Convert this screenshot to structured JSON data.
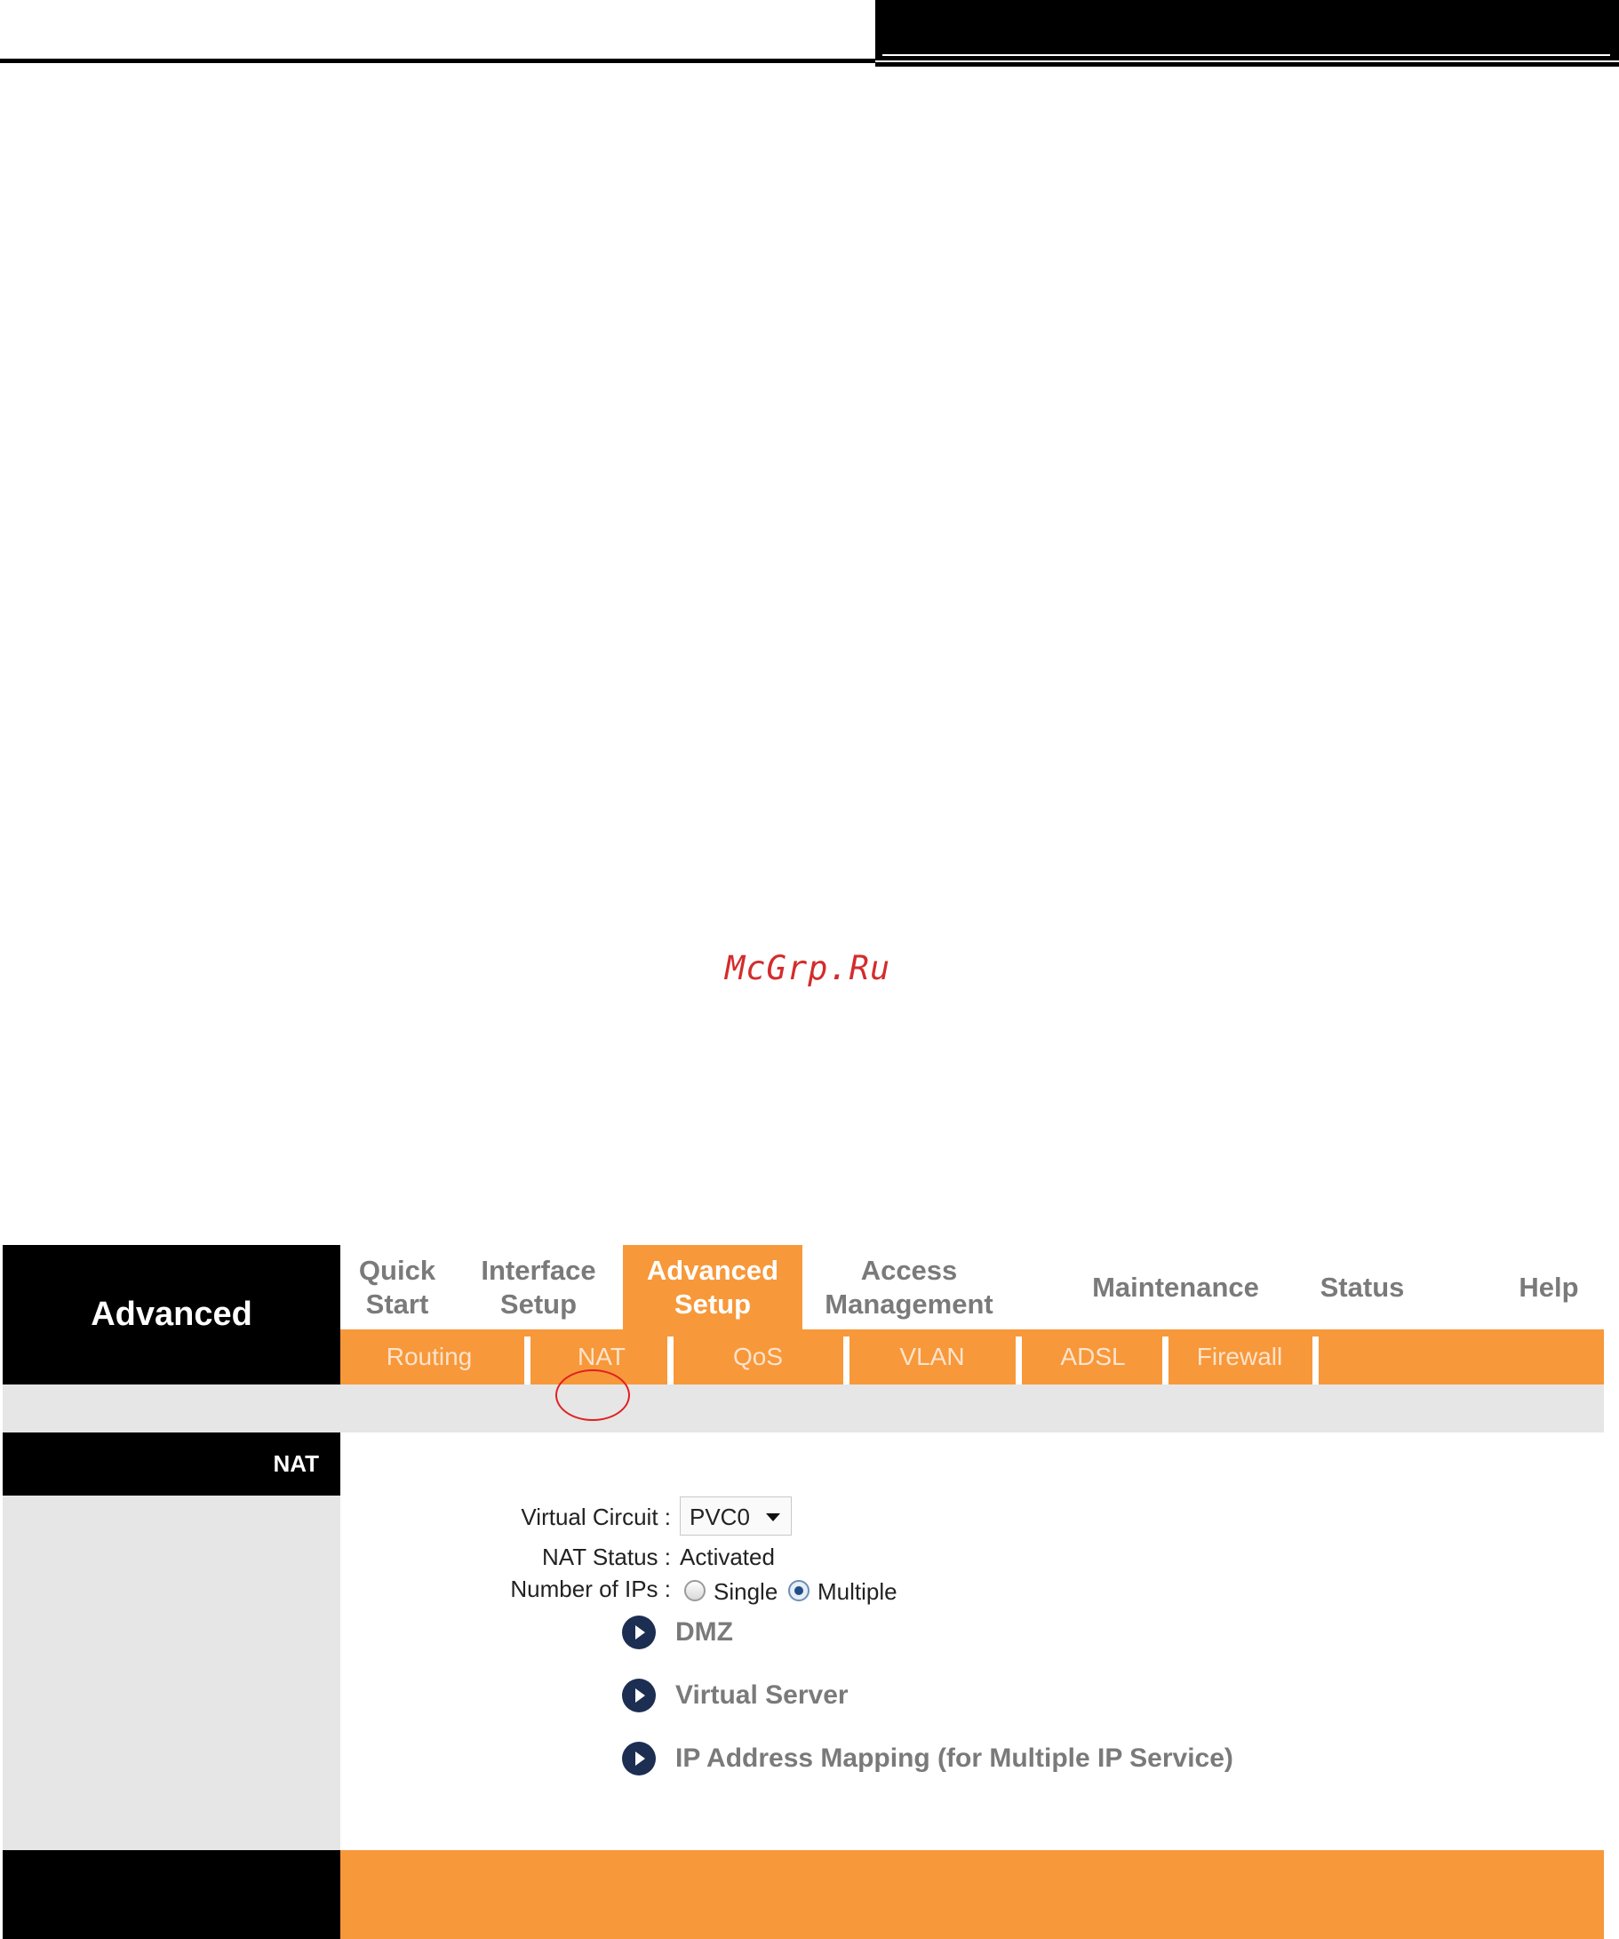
{
  "watermark": "McGrp.Ru",
  "app": {
    "section_title": "Advanced"
  },
  "nav": {
    "tabs": [
      {
        "label_line1": "Quick",
        "label_line2": "Start"
      },
      {
        "label_line1": "Interface",
        "label_line2": "Setup"
      },
      {
        "label_line1": "Advanced",
        "label_line2": "Setup"
      },
      {
        "label_line1": "Access",
        "label_line2": "Management"
      },
      {
        "label_line1": "Maintenance"
      },
      {
        "label_line1": "Status"
      },
      {
        "label_line1": "Help"
      }
    ],
    "active_tab": "Advanced Setup",
    "subtabs": [
      "Routing",
      "NAT",
      "QoS",
      "VLAN",
      "ADSL",
      "Firewall"
    ]
  },
  "nat": {
    "section_label": "NAT",
    "virtual_circuit": {
      "label": "Virtual Circuit :",
      "value": "PVC0"
    },
    "nat_status": {
      "label": "NAT Status :",
      "value": "Activated"
    },
    "number_of_ips": {
      "label": "Number of IPs :",
      "options": [
        "Single",
        "Multiple"
      ],
      "selected": "Multiple"
    },
    "links": [
      "DMZ",
      "Virtual Server",
      "IP Address Mapping (for Multiple IP Service)"
    ]
  },
  "colors": {
    "accent": "#f7983a",
    "header_bg": "#000000",
    "panel_gray": "#e6e6e6",
    "annotation": "#e02020"
  }
}
